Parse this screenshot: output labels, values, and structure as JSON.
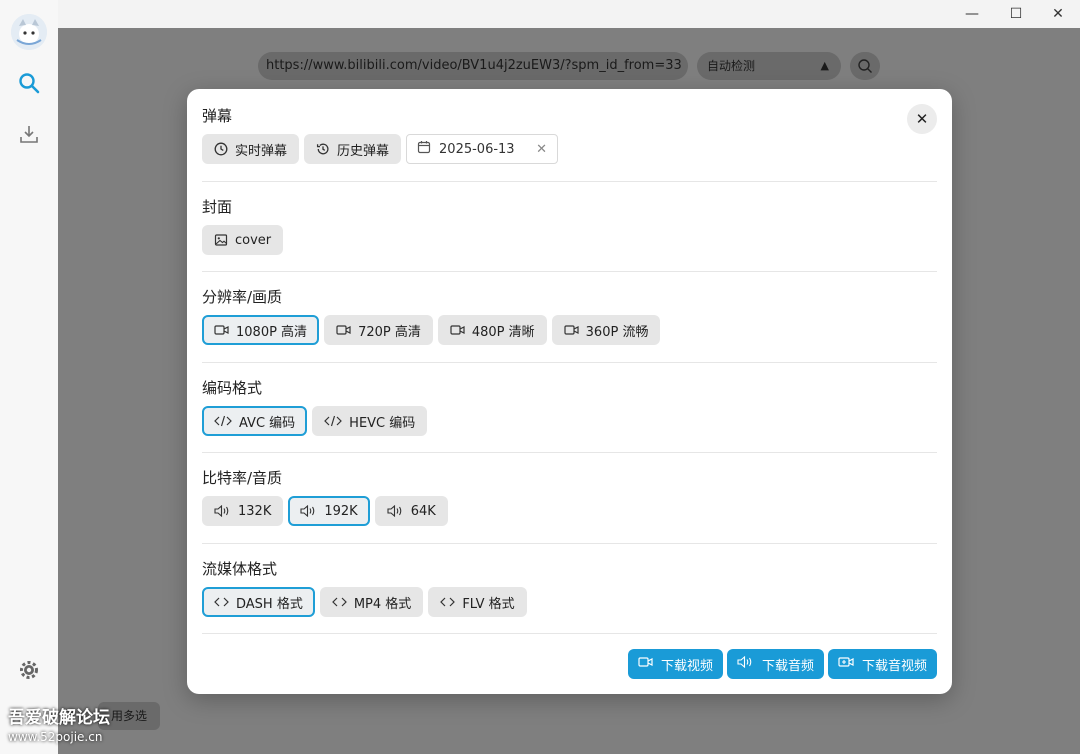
{
  "window": {
    "minimize": "—",
    "maximize": "☐",
    "close": "✕"
  },
  "background": {
    "url_value": "https://www.bilibili.com/video/BV1u4j2zuEW3/?spm_id_from=33",
    "mode_select": "自动检测",
    "multiselect_label": "用多选"
  },
  "watermark": {
    "text": "吾爱破解论坛",
    "url": "www.52pojie.cn"
  },
  "modal": {
    "danmaku": {
      "title": "弹幕",
      "realtime_label": "实时弹幕",
      "history_label": "历史弹幕",
      "date_value": "2025-06-13"
    },
    "cover": {
      "title": "封面",
      "cover_label": "cover"
    },
    "resolution": {
      "title": "分辨率/画质",
      "options": [
        "1080P 高清",
        "720P 高清",
        "480P 清晰",
        "360P 流畅"
      ],
      "selected": "1080P 高清"
    },
    "codec": {
      "title": "编码格式",
      "options": [
        "AVC 编码",
        "HEVC 编码"
      ],
      "selected": "AVC 编码"
    },
    "bitrate": {
      "title": "比特率/音质",
      "options": [
        "132K",
        "192K",
        "64K"
      ],
      "selected": "192K"
    },
    "stream": {
      "title": "流媒体格式",
      "options": [
        "DASH 格式",
        "MP4 格式",
        "FLV 格式"
      ],
      "selected": "DASH 格式"
    },
    "actions": {
      "download_video": "下载视频",
      "download_audio": "下载音频",
      "download_av": "下载音视频"
    }
  },
  "colors": {
    "accent": "#1a9bd7",
    "chip_bg": "#e6e6e6",
    "overlay": "#7f7f7f"
  }
}
